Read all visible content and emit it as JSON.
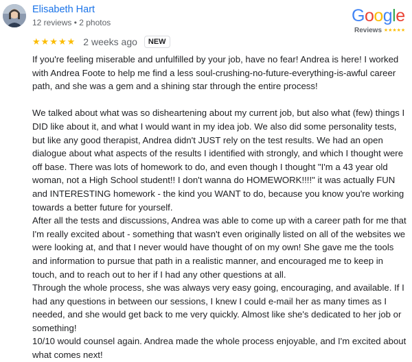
{
  "reviewer": {
    "name": "Elisabeth Hart",
    "meta": "12 reviews • 2 photos"
  },
  "badge": {
    "google_letters": [
      "G",
      "o",
      "o",
      "g",
      "l",
      "e"
    ],
    "reviews_label": "Reviews",
    "reviews_stars": "★★★★★"
  },
  "rating": {
    "stars": "★★★★★",
    "value": 5,
    "date": "2 weeks ago",
    "new_label": "NEW"
  },
  "review": {
    "paragraphs": [
      "If you're feeling miserable and unfulfilled by your job, have no fear! Andrea is here! I worked with Andrea Foote to help me find a less soul-crushing-no-future-everything-is-awful career path, and she was a gem and a shining star through the entire process!",
      "We talked about what was so disheartening about my current job, but also what (few) things I DID like about it, and what I would want in my idea job. We also did some personality tests, but like any good therapist, Andrea didn't JUST rely on the test results. We had an open dialogue about what aspects of the results I identified with strongly, and which I thought were off base. There was lots of homework to do, and even though I thought \"I'm a 43 year old woman, not a High School student!! I don't wanna do HOMEWORK!!!!\" it was actually FUN and INTERESTING homework - the kind you WANT to do, because you know you're working towards a better future for yourself.",
      "After all the tests and discussions, Andrea was able to come up with a career path for me that I'm really excited about - something that wasn't even originally listed on all of the websites we were looking at, and that I never would have thought of on my own! She gave me the tools and information to pursue that path in a realistic manner, and encouraged me to keep in touch, and to reach out to her if I had any other questions at all.",
      "Through the whole process, she was always very easy going, encouraging, and available. If I had any questions in between our sessions, I knew I could e-mail her as many times as I needed, and she would get back to me very quickly. Almost like she's dedicated to her job or something!",
      "10/10 would counsel again. Andrea made the whole process enjoyable, and I'm excited about what comes next!"
    ]
  }
}
